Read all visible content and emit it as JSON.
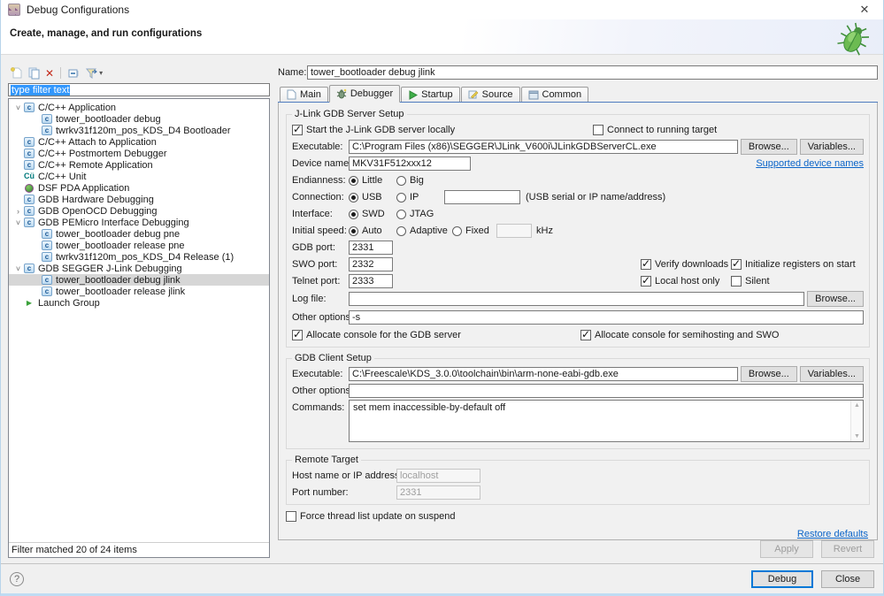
{
  "window": {
    "title": "Debug Configurations",
    "close_glyph": "✕",
    "help_glyph": "?"
  },
  "colors": {
    "selection_blue": "#3297fd",
    "link_blue": "#0a64c8",
    "focus_accent": "#0078d7",
    "beetle_green": "#55a845"
  },
  "banner": {
    "subtitle": "Create, manage, and run configurations"
  },
  "left": {
    "filter_text": "type filter text",
    "status": "Filter matched 20 of 24 items",
    "tree": [
      {
        "label": "C/C++ Application",
        "icon": "c",
        "lvl": 0,
        "arrow": "e"
      },
      {
        "label": "tower_bootloader debug",
        "icon": "c",
        "lvl": 1
      },
      {
        "label": "twrkv31f120m_pos_KDS_D4 Bootloader",
        "icon": "c",
        "lvl": 1
      },
      {
        "label": "C/C++ Attach to Application",
        "icon": "c",
        "lvl": 0
      },
      {
        "label": "C/C++ Postmortem Debugger",
        "icon": "c",
        "lvl": 0
      },
      {
        "label": "C/C++ Remote Application",
        "icon": "c",
        "lvl": 0
      },
      {
        "label": "C/C++ Unit",
        "icon": "cu",
        "lvl": 0
      },
      {
        "label": "DSF PDA Application",
        "icon": "bug",
        "lvl": 0
      },
      {
        "label": "GDB Hardware Debugging",
        "icon": "c",
        "lvl": 0
      },
      {
        "label": "GDB OpenOCD Debugging",
        "icon": "c",
        "lvl": 0,
        "arrow": "c"
      },
      {
        "label": "GDB PEMicro Interface Debugging",
        "icon": "c",
        "lvl": 0,
        "arrow": "e"
      },
      {
        "label": "tower_bootloader debug pne",
        "icon": "c",
        "lvl": 1
      },
      {
        "label": "tower_bootloader release pne",
        "icon": "c",
        "lvl": 1
      },
      {
        "label": "twrkv31f120m_pos_KDS_D4 Release (1)",
        "icon": "c",
        "lvl": 1
      },
      {
        "label": "GDB SEGGER J-Link Debugging",
        "icon": "c",
        "lvl": 0,
        "arrow": "e"
      },
      {
        "label": "tower_bootloader debug jlink",
        "icon": "c",
        "lvl": 1,
        "sel": true
      },
      {
        "label": "tower_bootloader release jlink",
        "icon": "c",
        "lvl": 1
      },
      {
        "label": "Launch Group",
        "icon": "launch",
        "lvl": 0
      }
    ]
  },
  "form": {
    "name": {
      "label": "Name:",
      "value": "tower_bootloader debug jlink"
    },
    "tabs": [
      {
        "label": "Main"
      },
      {
        "label": "Debugger",
        "selected": true
      },
      {
        "label": "Startup"
      },
      {
        "label": "Source"
      },
      {
        "label": "Common"
      }
    ],
    "server": {
      "title": "J-Link GDB Server Setup",
      "start_locally": {
        "label": "Start the J-Link GDB server locally",
        "checked": true
      },
      "connect_running": {
        "label": "Connect to running target",
        "checked": false
      },
      "executable": {
        "label": "Executable:",
        "value": "C:\\Program Files (x86)\\SEGGER\\JLink_V600i\\JLinkGDBServerCL.exe",
        "browse": "Browse...",
        "variables": "Variables..."
      },
      "device": {
        "label": "Device name:",
        "value": "MKV31F512xxx12",
        "link": "Supported device names"
      },
      "endianness": {
        "label": "Endianness:",
        "options": [
          {
            "label": "Little",
            "selected": true
          },
          {
            "label": "Big",
            "selected": false
          }
        ]
      },
      "connection": {
        "label": "Connection:",
        "options": [
          {
            "label": "USB",
            "selected": true
          },
          {
            "label": "IP",
            "selected": false
          }
        ],
        "value": "",
        "hint": "(USB serial or IP name/address)"
      },
      "interface": {
        "label": "Interface:",
        "options": [
          {
            "label": "SWD",
            "selected": true
          },
          {
            "label": "JTAG",
            "selected": false
          }
        ]
      },
      "initial_speed": {
        "label": "Initial speed:",
        "options": [
          {
            "label": "Auto",
            "selected": true
          },
          {
            "label": "Adaptive",
            "selected": false
          },
          {
            "label": "Fixed",
            "selected": false
          }
        ],
        "value": "",
        "unit": "kHz"
      },
      "gdb_port": {
        "label": "GDB port:",
        "value": "2331"
      },
      "swo_port": {
        "label": "SWO port:",
        "value": "2332"
      },
      "telnet_port": {
        "label": "Telnet port:",
        "value": "2333"
      },
      "verify_downloads": {
        "label": "Verify downloads",
        "checked": true
      },
      "init_registers": {
        "label": "Initialize registers on start",
        "checked": true
      },
      "local_host_only": {
        "label": "Local host only",
        "checked": true
      },
      "silent": {
        "label": "Silent",
        "checked": false
      },
      "log_file": {
        "label": "Log file:",
        "value": "",
        "browse": "Browse..."
      },
      "other_options": {
        "label": "Other options:",
        "value": "-s"
      },
      "alloc_gdb_console": {
        "label": "Allocate console for the GDB server",
        "checked": true
      },
      "alloc_swo_console": {
        "label": "Allocate console for semihosting and SWO",
        "checked": true
      }
    },
    "client": {
      "title": "GDB Client Setup",
      "executable": {
        "label": "Executable:",
        "value": "C:\\Freescale\\KDS_3.0.0\\toolchain\\bin\\arm-none-eabi-gdb.exe",
        "browse": "Browse...",
        "variables": "Variables..."
      },
      "other_options": {
        "label": "Other options:",
        "value": ""
      },
      "commands": {
        "label": "Commands:",
        "value": "set mem inaccessible-by-default off"
      }
    },
    "remote": {
      "title": "Remote Target",
      "host": {
        "label": "Host name or IP address:",
        "value": "localhost"
      },
      "port": {
        "label": "Port number:",
        "value": "2331"
      }
    },
    "force_thread": {
      "label": "Force thread list update on suspend",
      "checked": false
    },
    "restore_link": "Restore defaults",
    "apply_label": "Apply",
    "revert_label": "Revert"
  },
  "footer": {
    "debug_label": "Debug",
    "close_label": "Close"
  }
}
